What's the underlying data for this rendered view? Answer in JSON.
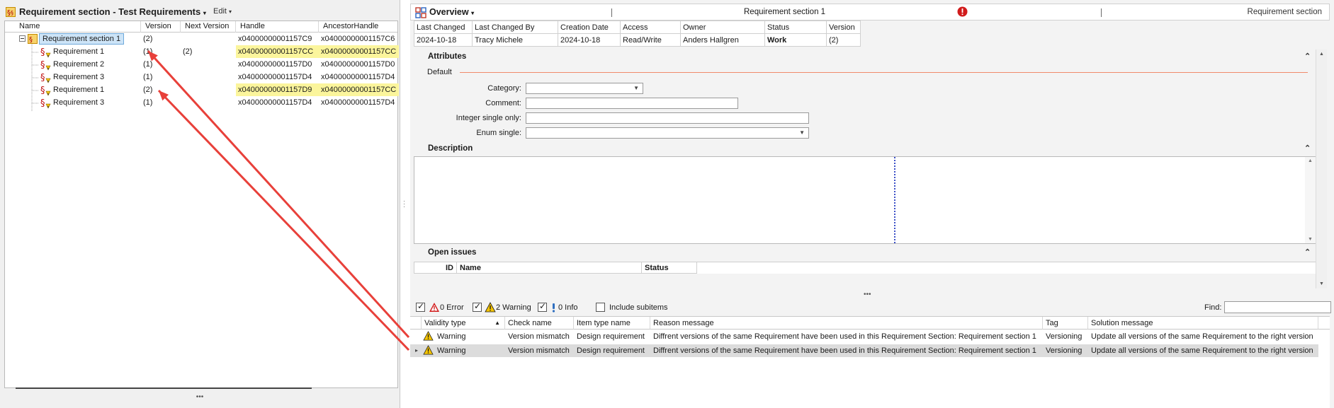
{
  "left": {
    "title": "Requirement section - Test Requirements",
    "edit_menu": "Edit",
    "columns": [
      "Name",
      "Version",
      "Next Version",
      "Handle",
      "AncestorHandle"
    ],
    "root": {
      "name": "Requirement section 1",
      "version": "(2)",
      "next_version": "",
      "handle": "x04000000001157C9",
      "ancestor": "x04000000001157C6"
    },
    "rows": [
      {
        "name": "Requirement 1",
        "version": "(1)",
        "next_version": "(2)",
        "handle": "x04000000001157CC",
        "ancestor": "x04000000001157CC",
        "highlight": true
      },
      {
        "name": "Requirement 2",
        "version": "(1)",
        "next_version": "",
        "handle": "x04000000001157D0",
        "ancestor": "x04000000001157D0",
        "highlight": false
      },
      {
        "name": "Requirement 3",
        "version": "(1)",
        "next_version": "",
        "handle": "x04000000001157D4",
        "ancestor": "x04000000001157D4",
        "highlight": false
      },
      {
        "name": "Requirement 1",
        "version": "(2)",
        "next_version": "",
        "handle": "x04000000001157D9",
        "ancestor": "x04000000001157CC",
        "highlight": true
      },
      {
        "name": "Requirement 3",
        "version": "(1)",
        "next_version": "",
        "handle": "x04000000001157D4",
        "ancestor": "x04000000001157D4",
        "highlight": false
      }
    ]
  },
  "right": {
    "view": "Overview",
    "object_name": "Requirement section 1",
    "object_type": "Requirement section",
    "meta_headers": [
      "Last Changed",
      "Last Changed By",
      "Creation Date",
      "Access",
      "Owner",
      "Status",
      "Version"
    ],
    "meta_values": [
      "2024-10-18",
      "Tracy Michele",
      "2024-10-18",
      "Read/Write",
      "Anders Hallgren",
      "Work",
      "(2)"
    ],
    "attributes_title": "Attributes",
    "default_group": "Default",
    "fields": [
      {
        "label": "Category:",
        "value": "",
        "type": "dropdown"
      },
      {
        "label": "Comment:",
        "value": "",
        "type": "text"
      },
      {
        "label": "Integer single only:",
        "value": "",
        "type": "text"
      },
      {
        "label": "Enum single:",
        "value": "",
        "type": "dropdown"
      }
    ],
    "description_title": "Description",
    "open_issues_title": "Open issues",
    "issues_columns": [
      "ID",
      "Name",
      "Status"
    ]
  },
  "validation": {
    "error_label": "0 Error",
    "warning_label": "2 Warning",
    "info_label": "0 Info",
    "include_subitems": "Include subitems",
    "find_label": "Find:",
    "find_value": "",
    "columns": [
      "Validity type",
      "Check name",
      "Item type name",
      "Reason message",
      "Tag",
      "Solution message"
    ],
    "rows": [
      {
        "validity": "Warning",
        "check": "Version mismatch",
        "item_type": "Design requirement",
        "reason": "Diffrent versions of the same Requirement have been used in this Requirement Section: Requirement section 1",
        "tag": "Versioning",
        "solution": "Update all versions of the same Requirement to the right version",
        "selected": false
      },
      {
        "validity": "Warning",
        "check": "Version mismatch",
        "item_type": "Design requirement",
        "reason": "Diffrent versions of the same Requirement have been used in this Requirement Section: Requirement section 1",
        "tag": "Versioning",
        "solution": "Update all versions of the same Requirement to the right version",
        "selected": true
      }
    ]
  },
  "colors": {
    "highlight": "#fbf59c",
    "selection": "#cde4f7",
    "arrow": "#e8403a",
    "warning": "#f5c400",
    "error": "#d11b1b"
  },
  "icons": [
    "section-icon",
    "requirement-icon",
    "overview-grid-icon",
    "error-icon",
    "warning-icon",
    "info-icon",
    "collapse-icon",
    "chevron-down-icon",
    "expand-minus-icon"
  ]
}
